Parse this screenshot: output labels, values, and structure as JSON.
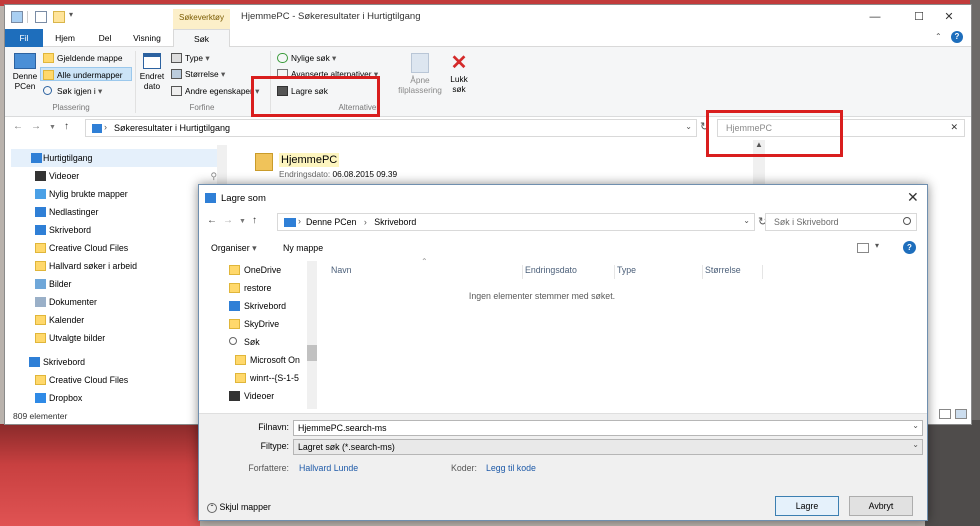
{
  "explorer": {
    "context_tab": "Søkeverktøy",
    "window_title": "HjemmePC - Søkeresultater i Hurtigtilgang",
    "tabs": [
      "Fil",
      "Hjem",
      "Del",
      "Visning",
      "Søk"
    ],
    "ribbon": {
      "plassering": {
        "denne_pcen": "Denne\nPCen",
        "gjeldende_mappe": "Gjeldende mappe",
        "alle_undermapper": "Alle undermapper",
        "sok_igjen_i": "Søk igjen i",
        "label": "Plassering"
      },
      "forfine": {
        "endret_dato": "Endret\ndato",
        "type": "Type",
        "storrelse": "Størrelse",
        "andre_egenskaper": "Andre egenskaper",
        "label": "Forfine"
      },
      "alternativer": {
        "nylige_sok": "Nylige søk",
        "avanserte_alternativer": "Avanserte alternativer",
        "lagre_sok": "Lagre søk",
        "label": "Alternativer"
      },
      "apne_filplassering": "Åpne\nfilplassering",
      "lukk_sok": "Lukk\nsøk"
    },
    "address": "Søkeresultater i Hurtigtilgang",
    "search_value": "HjemmePC",
    "nav": [
      {
        "label": "Hurtigtilgang",
        "icon": "star-icon"
      },
      {
        "label": "Videoer",
        "icon": "video-icon"
      },
      {
        "label": "Nylig brukte mapper",
        "icon": "recent-folder-icon"
      },
      {
        "label": "Nedlastinger",
        "icon": "download-icon"
      },
      {
        "label": "Skrivebord",
        "icon": "desktop-icon"
      },
      {
        "label": "Creative Cloud Files",
        "icon": "creative-cloud-icon"
      },
      {
        "label": "Hallvard søker i arbeid",
        "icon": "folder-icon"
      },
      {
        "label": "Bilder",
        "icon": "pictures-icon"
      },
      {
        "label": "Dokumenter",
        "icon": "documents-icon"
      },
      {
        "label": "Kalender",
        "icon": "folder-icon"
      },
      {
        "label": "Utvalgte bilder",
        "icon": "folder-icon"
      },
      {
        "label": "Skrivebord",
        "icon": "desktop-icon"
      },
      {
        "label": "Creative Cloud Files",
        "icon": "creative-cloud-icon"
      },
      {
        "label": "Dropbox",
        "icon": "dropbox-icon"
      }
    ],
    "status": "809 elementer",
    "result": {
      "title": "HjemmePC",
      "date_label": "Endringsdato:",
      "date_value": "06.08.2015 09.39"
    }
  },
  "dialog": {
    "title": "Lagre som",
    "address_parts": [
      "Denne PCen",
      "Skrivebord"
    ],
    "search_placeholder": "Søk i Skrivebord",
    "toolbar": {
      "organiser": "Organiser",
      "ny_mappe": "Ny mappe"
    },
    "tree": [
      {
        "label": "OneDrive",
        "icon": "folder-icon"
      },
      {
        "label": "restore",
        "icon": "folder-icon"
      },
      {
        "label": "Skrivebord",
        "icon": "desktop-icon"
      },
      {
        "label": "SkyDrive",
        "icon": "folder-icon"
      },
      {
        "label": "Søk",
        "icon": "search-icon"
      },
      {
        "label": "Microsoft On",
        "icon": "search-folder-icon"
      },
      {
        "label": "winrt--{S-1-5",
        "icon": "search-folder-icon"
      },
      {
        "label": "Videoer",
        "icon": "video-icon"
      }
    ],
    "columns": [
      "Navn",
      "Endringsdato",
      "Type",
      "Størrelse"
    ],
    "empty_message": "Ingen elementer stemmer med søket.",
    "filename_label": "Filnavn:",
    "filename_value": "HjemmePC.search-ms",
    "filetype_label": "Filtype:",
    "filetype_value": "Lagret søk (*.search-ms)",
    "authors_label": "Forfattere:",
    "authors_value": "Hallvard Lunde",
    "tags_label": "Koder:",
    "tags_value": "Legg til kode",
    "hide_folders": "Skjul mapper",
    "save_button": "Lagre",
    "cancel_button": "Avbryt"
  }
}
